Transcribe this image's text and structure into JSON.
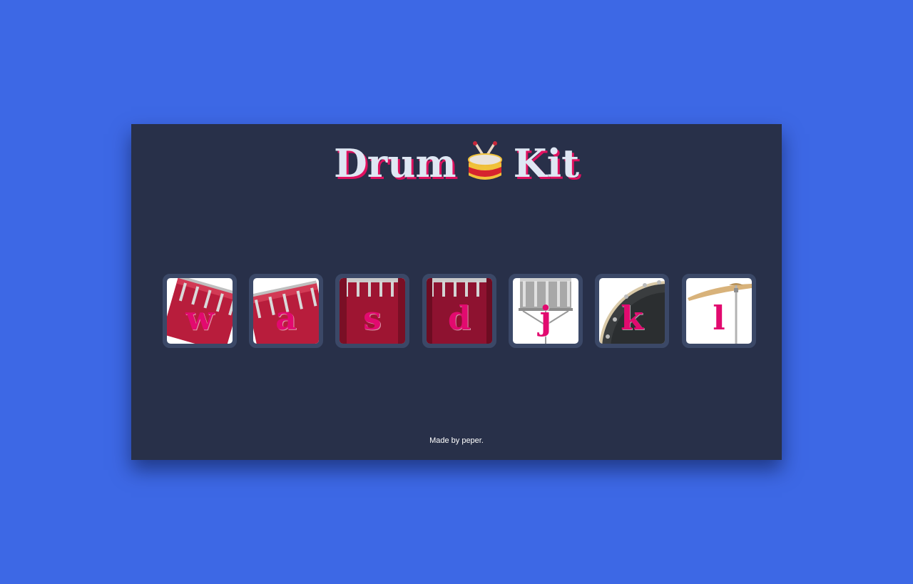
{
  "page": {
    "background_color": "#3d68e5",
    "panel_color": "#283049"
  },
  "header": {
    "title_left": "Drum",
    "title_right": "Kit",
    "title_icon": "drum-icon",
    "title_color": "#dfe7f3",
    "title_shadow_color": "#e0115f"
  },
  "pads": [
    {
      "key": "w",
      "instrument": "tom-drum-icon"
    },
    {
      "key": "a",
      "instrument": "tom-drum-icon"
    },
    {
      "key": "s",
      "instrument": "floor-tom-icon"
    },
    {
      "key": "d",
      "instrument": "floor-tom-icon"
    },
    {
      "key": "j",
      "instrument": "snare-drum-icon"
    },
    {
      "key": "k",
      "instrument": "bass-drum-icon"
    },
    {
      "key": "l",
      "instrument": "cymbal-icon"
    }
  ],
  "pad_style": {
    "border_color": "#3b4867",
    "key_color": "#e20a6f"
  },
  "footer": {
    "credit": "Made by peper."
  }
}
